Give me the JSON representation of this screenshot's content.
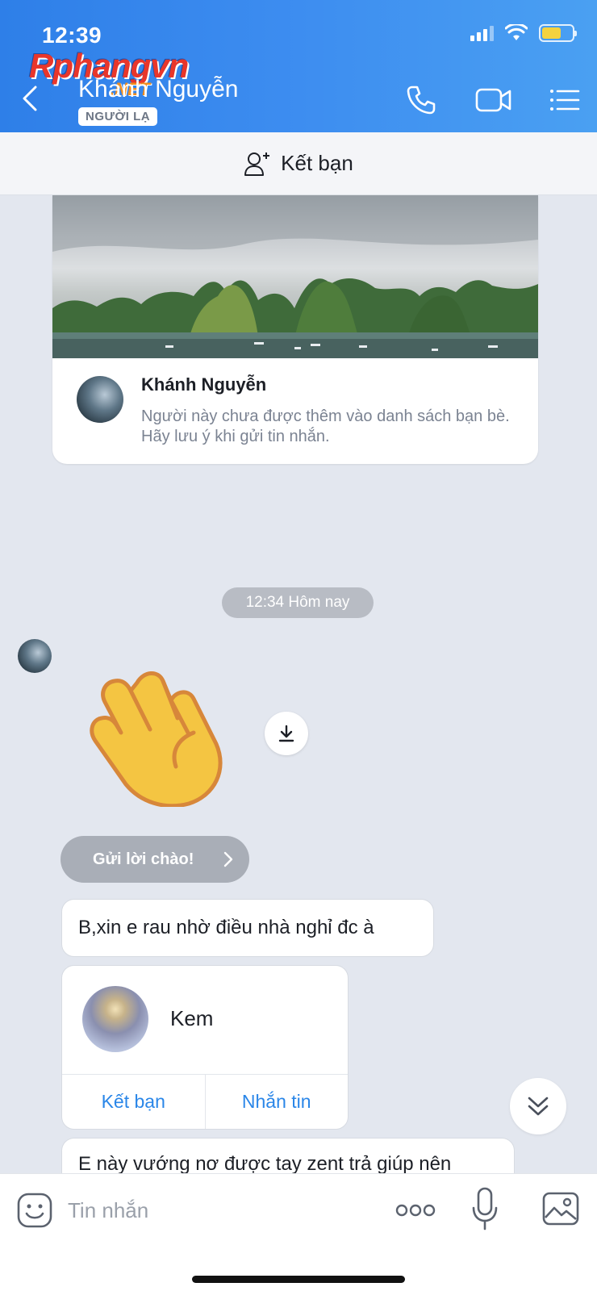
{
  "status_bar": {
    "time": "12:39",
    "battery_level": 0.65
  },
  "watermark": {
    "text": "Rphangvn",
    "suffix": ".NET"
  },
  "header": {
    "contact_name": "Khánh Nguyễn",
    "badge": "NGƯỜI LẠ",
    "icons": [
      "back-icon",
      "phone-icon",
      "video-call-icon",
      "menu-list-icon"
    ]
  },
  "add_friend_bar": {
    "label": "Kết bạn"
  },
  "profile_card": {
    "name": "Khánh Nguyễn",
    "description": "Người này chưa được thêm vào danh sách bạn bè. Hãy lưu ý khi gửi tin nhắn."
  },
  "chat": {
    "time_chip": "12:34 Hôm nay",
    "greet_button": "Gửi lời chào!",
    "messages": [
      {
        "text": "B,xin e rau nhờ điều nhà nghỉ đc à"
      },
      {
        "text": "E này vướng nơ được tay zent trả giúp nên"
      }
    ],
    "contact_card": {
      "name": "Kem",
      "add_friend": "Kết bạn",
      "message": "Nhắn tin"
    }
  },
  "input_bar": {
    "placeholder": "Tin nhắn"
  },
  "colors": {
    "header_start": "#2e7fe8",
    "header_end": "#4aa0f2",
    "chat_bg": "#e3e7ef",
    "link_blue": "#2a86e8",
    "chip_gray": "#b8bcc4"
  }
}
